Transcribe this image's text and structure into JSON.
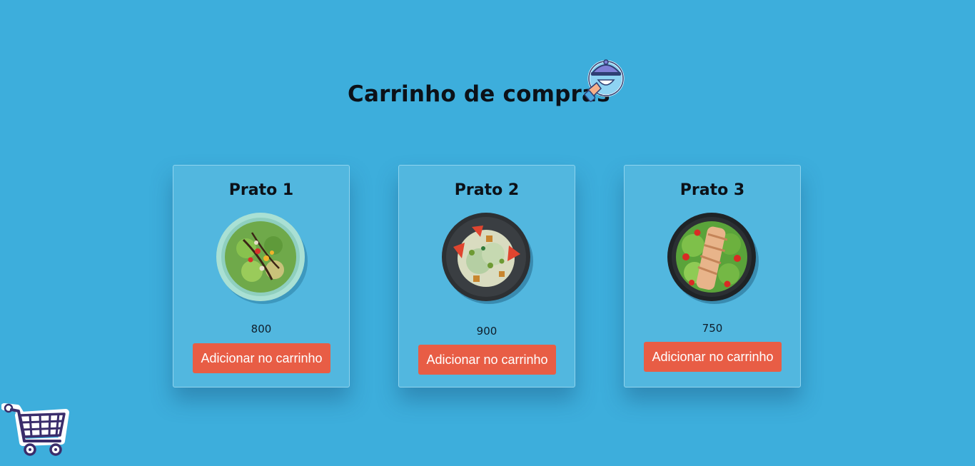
{
  "header": {
    "title": "Carrinho de compras",
    "icon": "waiter-icon"
  },
  "products": [
    {
      "name": "Prato 1",
      "price": "800",
      "button_label": "Adicionar no carrinho",
      "image": "salad-plate-icon"
    },
    {
      "name": "Prato 2",
      "price": "900",
      "button_label": "Adicionar no carrinho",
      "image": "salad-plate-icon"
    },
    {
      "name": "Prato 3",
      "price": "750",
      "button_label": "Adicionar no carrinho",
      "image": "salad-plate-icon"
    }
  ],
  "cart": {
    "icon": "shopping-cart-icon"
  },
  "colors": {
    "background": "#3daedc",
    "card": "#52b7df",
    "button": "#e85d45",
    "title": "#0c1118"
  }
}
